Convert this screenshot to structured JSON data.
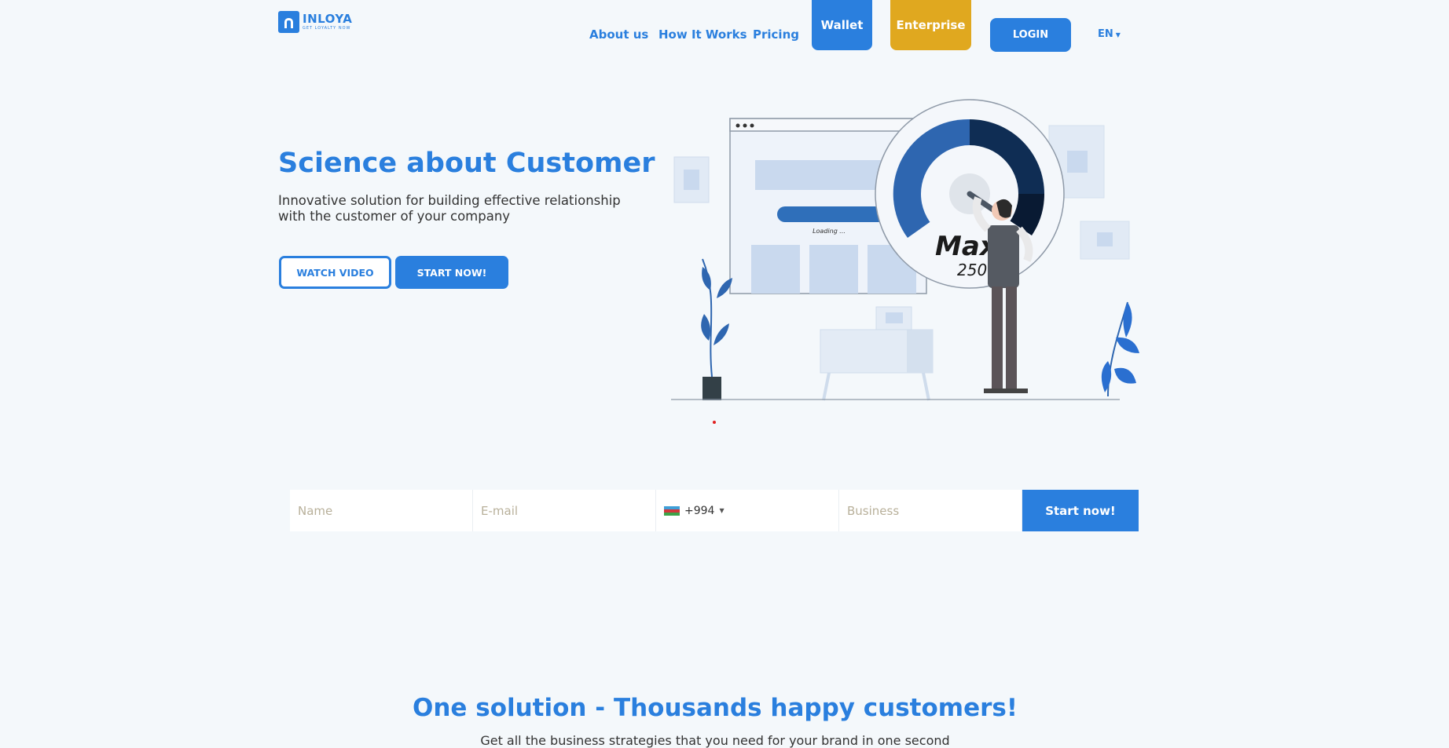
{
  "brand": {
    "name": "INLOYA",
    "tagline": "GET LOYALTY NOW"
  },
  "nav": {
    "about": "About us",
    "how": "How It Works",
    "pricing": "Pricing",
    "wallet": "Wallet",
    "enterprise": "Enterprise",
    "login": "LOGIN",
    "lang": "EN"
  },
  "hero": {
    "title": "Science about Customer",
    "subtitle": "Innovative solution for building effective relationship with the customer of your company",
    "watch_video": "WATCH VIDEO",
    "start_now": "START NOW!",
    "illustration": {
      "loading_text": "Loading ...",
      "gauge_text": "Max",
      "gauge_number": "250"
    }
  },
  "form": {
    "name_placeholder": "Name",
    "email_placeholder": "E-mail",
    "phone_code": "+994",
    "business_placeholder": "Business",
    "submit": "Start now!"
  },
  "section": {
    "title": "One solution - Thousands happy customers!",
    "subtitle": "Get all the business strategies that you need for your brand in one second"
  },
  "colors": {
    "primary": "#2a7fde",
    "enterprise": "#e0a81f",
    "background": "#f4f8fb"
  }
}
